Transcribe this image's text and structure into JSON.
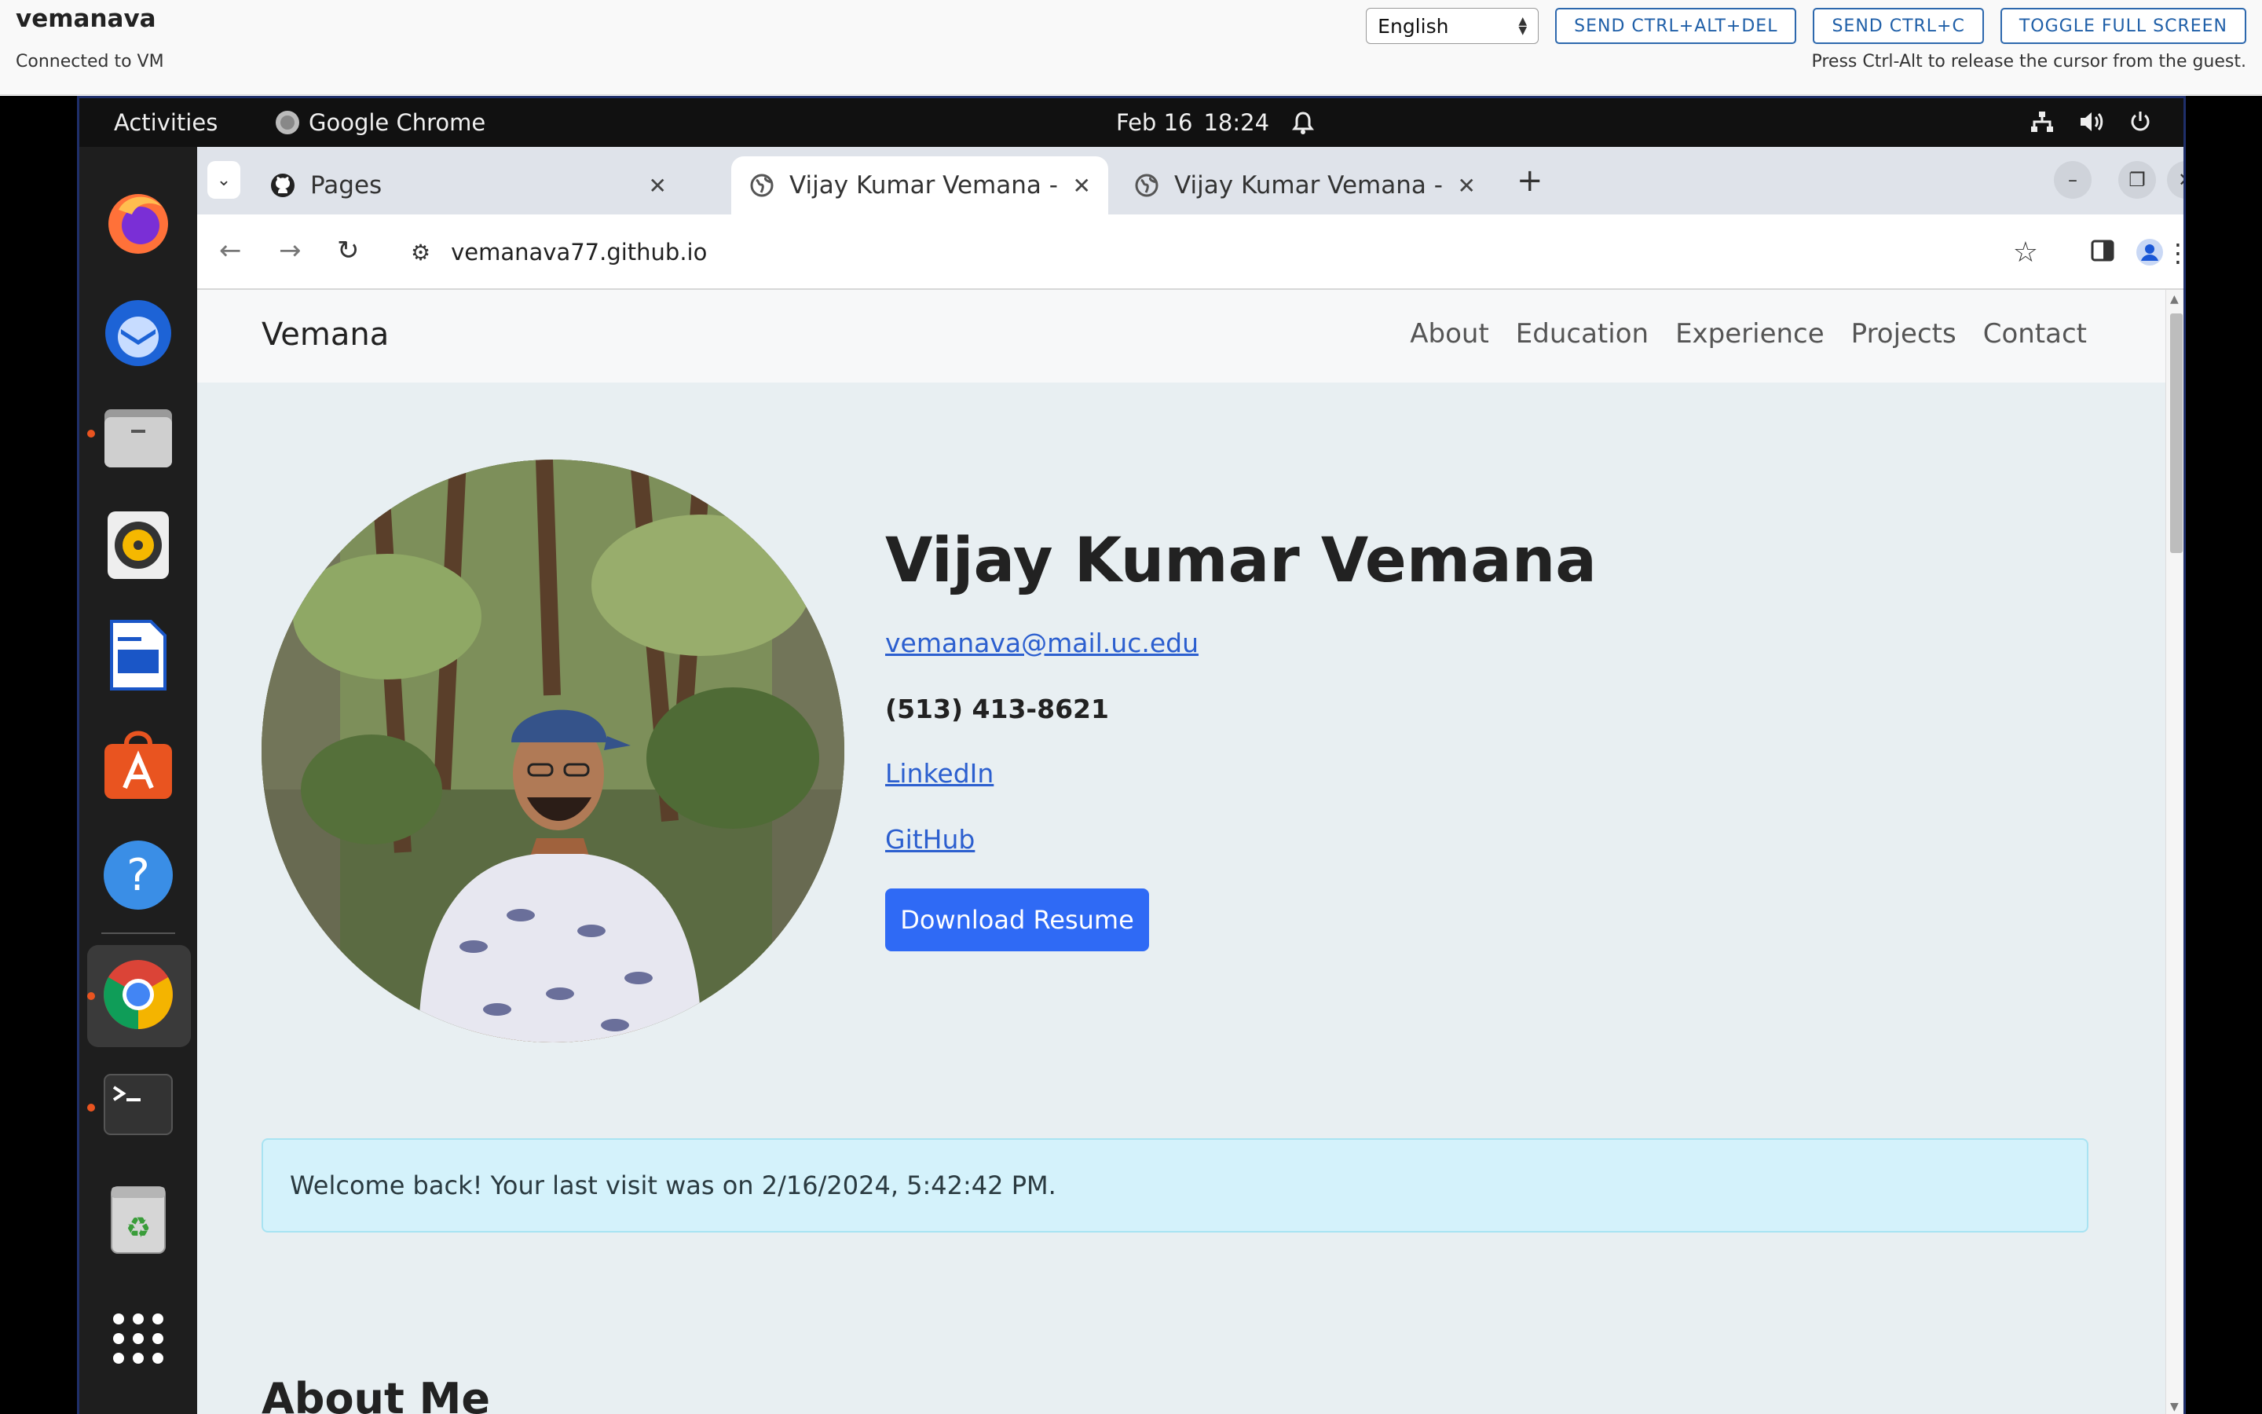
{
  "vm_header": {
    "name": "vemanava",
    "status": "Connected to VM",
    "language": "English",
    "buttons": [
      "SEND CTRL+ALT+DEL",
      "SEND CTRL+C",
      "TOGGLE FULL SCREEN"
    ],
    "hint": "Press Ctrl-Alt to release the cursor from the guest."
  },
  "top_bar": {
    "activities": "Activities",
    "app_name": "Google Chrome",
    "date": "Feb 16",
    "time": "18:24"
  },
  "dock": {
    "icons": [
      "firefox-icon",
      "thunderbird-icon",
      "files-icon",
      "rhythmbox-icon",
      "writer-icon",
      "app-center-icon",
      "help-icon",
      "chrome-icon",
      "terminal-icon",
      "trash-icon",
      "app-grid-icon"
    ]
  },
  "browser": {
    "tabs": [
      {
        "title": "Pages",
        "active": false
      },
      {
        "title": "Vijay Kumar Vemana - Pr",
        "active": true
      },
      {
        "title": "Vijay Kumar Vemana - Pr",
        "active": false
      }
    ],
    "url": "vemanava77.github.io"
  },
  "site": {
    "brand": "Vemana",
    "nav": [
      "About",
      "Education",
      "Experience",
      "Projects",
      "Contact"
    ],
    "hero": {
      "name": "Vijay Kumar Vemana",
      "email": "vemanava@mail.uc.edu",
      "phone": "(513) 413-8621",
      "linkedin": "LinkedIn",
      "github": "GitHub",
      "resume_button": "Download Resume"
    },
    "alert": "Welcome back! Your last visit was on 2/16/2024, 5:42:42 PM.",
    "about_heading": "About Me"
  },
  "colors": {
    "accent": "#2f6af5",
    "link": "#2c5fcf",
    "alert_bg": "#d4f2fb",
    "ubuntu_orange": "#e95420"
  }
}
